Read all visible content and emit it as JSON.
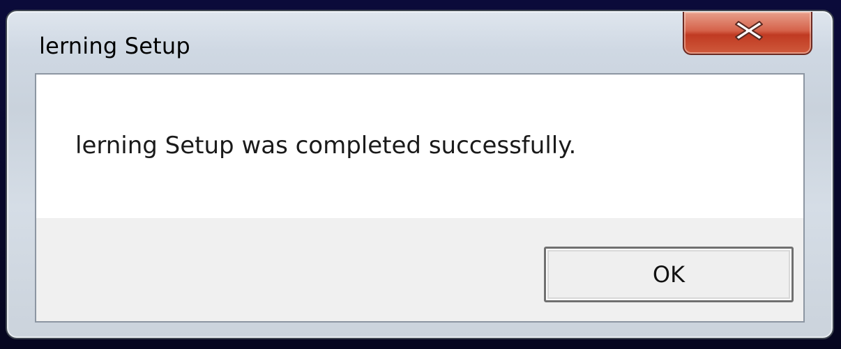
{
  "dialog": {
    "title": "lerning Setup",
    "message": "lerning Setup was completed successfully.",
    "ok_label": "OK",
    "close_icon": "close-icon"
  },
  "colors": {
    "close_button": "#c8432a",
    "desktop_background": "#0b0b3a"
  }
}
